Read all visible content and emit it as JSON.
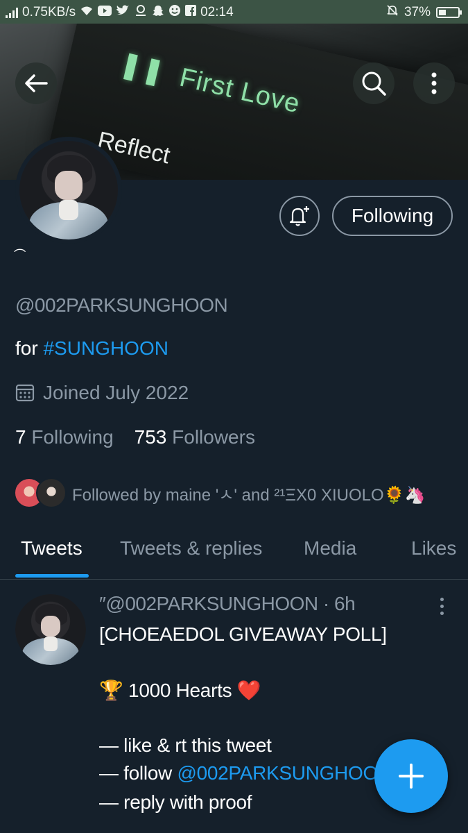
{
  "status_bar": {
    "network_speed": "0.75KB/s",
    "time": "02:14",
    "battery": "37%",
    "battery_level": 0.37
  },
  "banner": {
    "song_primary": "First Love",
    "song_secondary": "Reflect"
  },
  "profile": {
    "display_name": "͡",
    "handle": "@002PARKSUNGHOON",
    "bio_prefix": "for ",
    "bio_hashtag": "#SUNGHOON",
    "joined": "Joined July 2022",
    "following_count": "7",
    "following_label": "Following",
    "followers_count": "753",
    "followers_label": "Followers",
    "followed_by": "Followed by maine 'ㅅ' and ²¹ΞX0 XIUOLO🌻🦄",
    "follow_button": "Following"
  },
  "tabs": [
    "Tweets",
    "Tweets & replies",
    "Media",
    "Likes"
  ],
  "tweet": {
    "header": "″@002PARKSUNGHOON · 6h",
    "lines": [
      "[CHOEAEDOL GIVEAWAY POLL]",
      "🏆 1000 Hearts ❤️",
      "— like & rt this tweet",
      "— follow ",
      "@002PARKSUNGHOON",
      "— reply with proof"
    ]
  },
  "icons": {
    "back": "back-arrow-icon",
    "search": "search-icon",
    "more": "more-vertical-icon",
    "bell": "bell-plus-icon",
    "calendar": "calendar-icon",
    "compose": "plus-icon"
  },
  "colors": {
    "background": "#15202b",
    "accent": "#1d9bf0",
    "secondary_text": "#8b98a5",
    "status_bar": "#3c5445"
  }
}
